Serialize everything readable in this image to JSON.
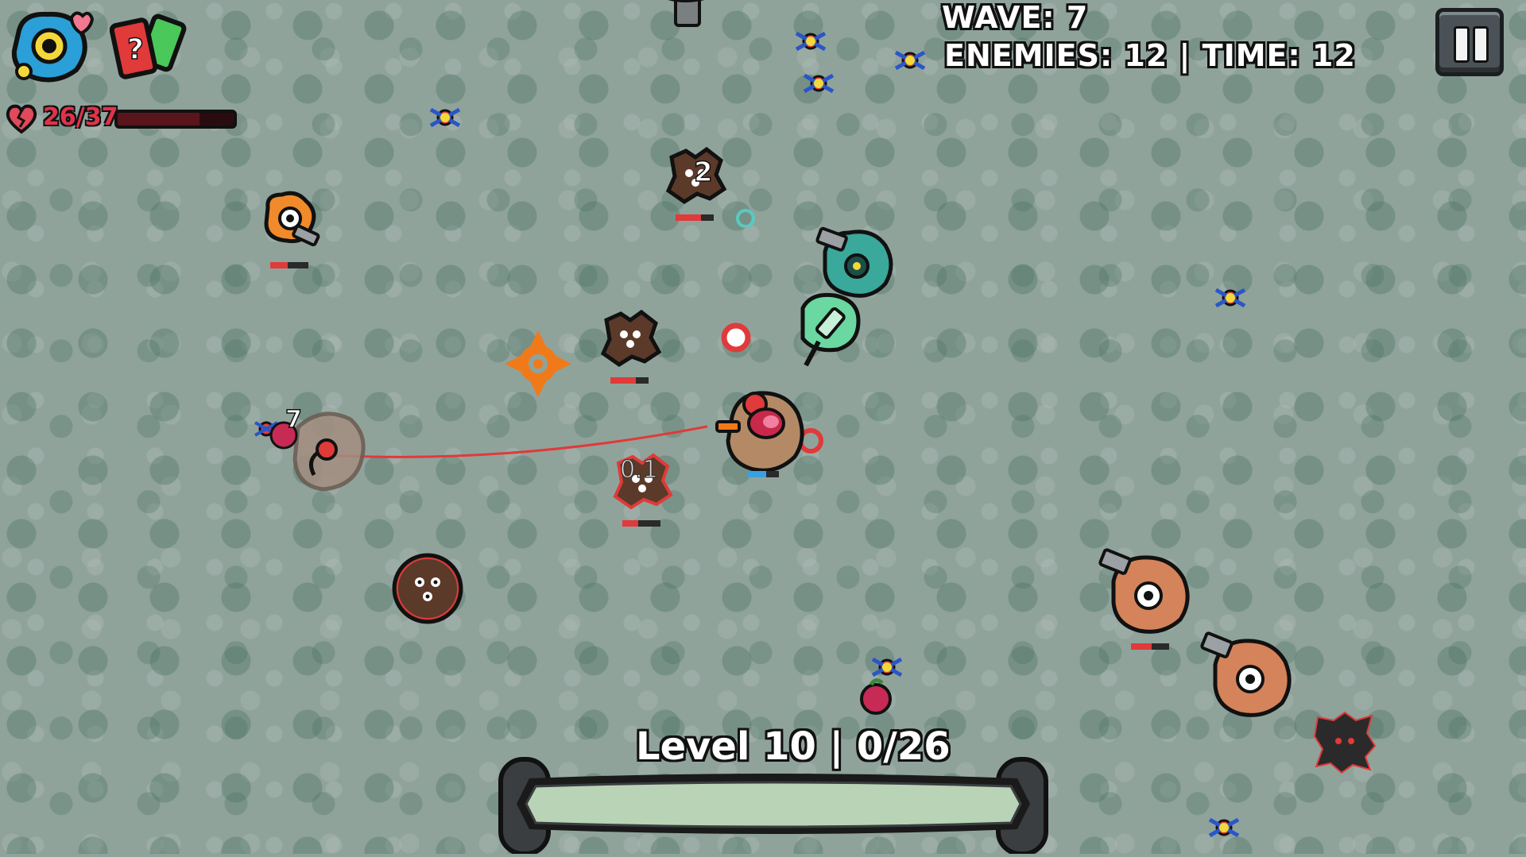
{
  "hud": {
    "wave_label": "WAVE: 7",
    "enemies_time_label": "ENEMIES: 12 | TIME: 12",
    "health_text": "26/37",
    "health": {
      "current": 26,
      "max": 37
    },
    "level_label": "Level 10 | 0/26",
    "xp": {
      "current": 0,
      "max": 26
    }
  },
  "floating_numbers": {
    "n1": "2",
    "n2": "7",
    "n3": "0.1"
  },
  "icons": {
    "ability_1": "eye-cell-hearts-icon",
    "ability_2": "mystery-cards-icon",
    "pause": "pause-icon",
    "health": "broken-heart-icon"
  },
  "colors": {
    "background": "#8fa39b",
    "health_text": "#e0334a",
    "enemy_body": "#5b3a2a",
    "turret_orange": "#f08a2a",
    "player_teal": "#3aa89a",
    "laser": "#e03a3a"
  }
}
